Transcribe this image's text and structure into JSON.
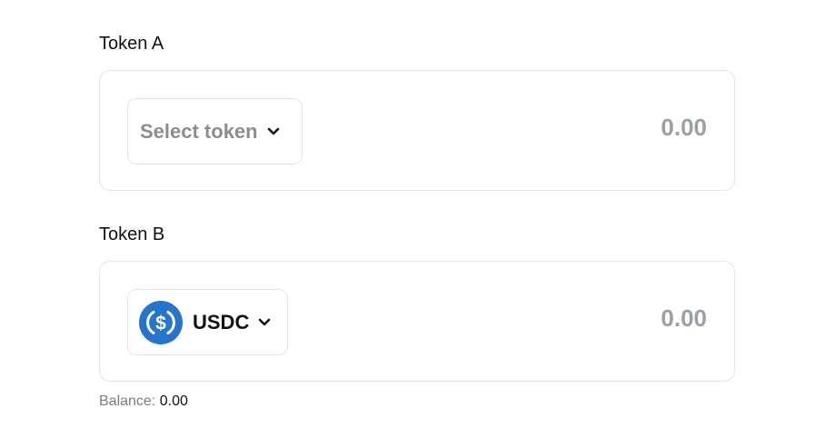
{
  "token_a": {
    "label": "Token A",
    "select_placeholder": "Select token",
    "amount_placeholder": "0.00"
  },
  "token_b": {
    "label": "Token B",
    "selected_token": "USDC",
    "token_icon": "usdc-icon",
    "amount_placeholder": "0.00",
    "balance_label": "Balance:",
    "balance_value": "0.00"
  },
  "colors": {
    "usdc_blue": "#2775ca",
    "panel_border": "#e3e5e8",
    "muted_text": "#8a8d92",
    "amount_text": "#9aa0a6"
  },
  "icons": {
    "dropdown": "chevron-down-icon"
  }
}
